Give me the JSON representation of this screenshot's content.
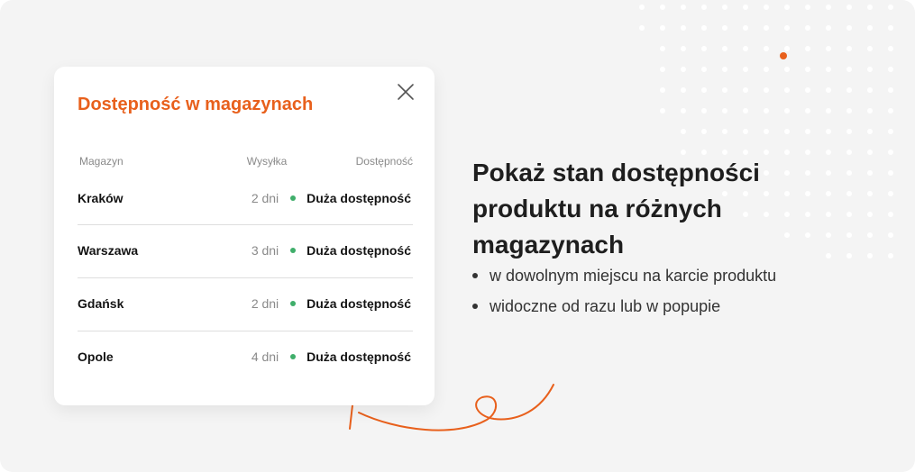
{
  "colors": {
    "accent": "#e8601c",
    "available": "#3fae6a",
    "background": "#f4f4f4",
    "card": "#ffffff"
  },
  "popup": {
    "title": "Dostępność w magazynach",
    "close_icon": "close-icon",
    "columns": {
      "warehouse": "Magazyn",
      "shipping": "Wysyłka",
      "availability": "Dostępność"
    },
    "rows": [
      {
        "warehouse": "Kraków",
        "shipping": "2 dni",
        "availability": "Duża dostępność"
      },
      {
        "warehouse": "Warszawa",
        "shipping": "3 dni",
        "availability": "Duża dostępność"
      },
      {
        "warehouse": "Gdańsk",
        "shipping": "2 dni",
        "availability": "Duża dostępność"
      },
      {
        "warehouse": "Opole",
        "shipping": "4 dni",
        "availability": "Duża dostępność"
      }
    ]
  },
  "promo": {
    "heading": "Pokaż stan dostępności produktu na różnych magazynach",
    "bullets": [
      "w dowolnym miejscu na karcie produktu",
      "widoczne od razu lub w popupie"
    ]
  }
}
